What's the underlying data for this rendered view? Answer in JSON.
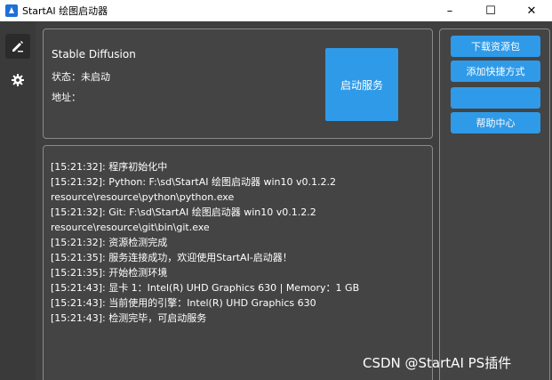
{
  "window": {
    "title": "StartAI 绘图启动器",
    "controls": {
      "minimize": "–",
      "maximize": "☐",
      "close": "✕"
    }
  },
  "nav": {
    "items": [
      {
        "icon": "pencil-icon",
        "active": true
      },
      {
        "icon": "gear-icon",
        "active": false
      }
    ]
  },
  "info": {
    "app_name": "Stable Diffusion",
    "status_label": "状态：",
    "status_value": "未启动",
    "address_label": "地址：",
    "address_value": "",
    "start_button": "启动服务"
  },
  "log": {
    "lines": [
      "[15:21:32]: 程序初始化中",
      "[15:21:32]: Python: F:\\sd\\StartAI 绘图启动器 win10 v0.1.2.2",
      "resource\\resource\\python\\python.exe",
      "[15:21:32]: Git: F:\\sd\\StartAI 绘图启动器 win10 v0.1.2.2",
      "resource\\resource\\git\\bin\\git.exe",
      "[15:21:32]: 资源检测完成",
      "[15:21:35]: 服务连接成功，欢迎使用StartAI-启动器！",
      "[15:21:35]: 开始检测环境",
      "[15:21:43]: 显卡 1：Intel(R) UHD Graphics 630 | Memory：1 GB",
      "[15:21:43]: 当前使用的引擎：Intel(R) UHD Graphics 630",
      "[15:21:43]: 检测完毕，可启动服务"
    ]
  },
  "side": {
    "download_button": "下载资源包",
    "shortcut_button": "添加快捷方式",
    "blank_button": "",
    "help_button": "帮助中心"
  },
  "watermark": "CSDN @StartAI PS插件",
  "colors": {
    "accent": "#2f9ae8",
    "background": "#3f3f3f",
    "panel": "#444444"
  }
}
